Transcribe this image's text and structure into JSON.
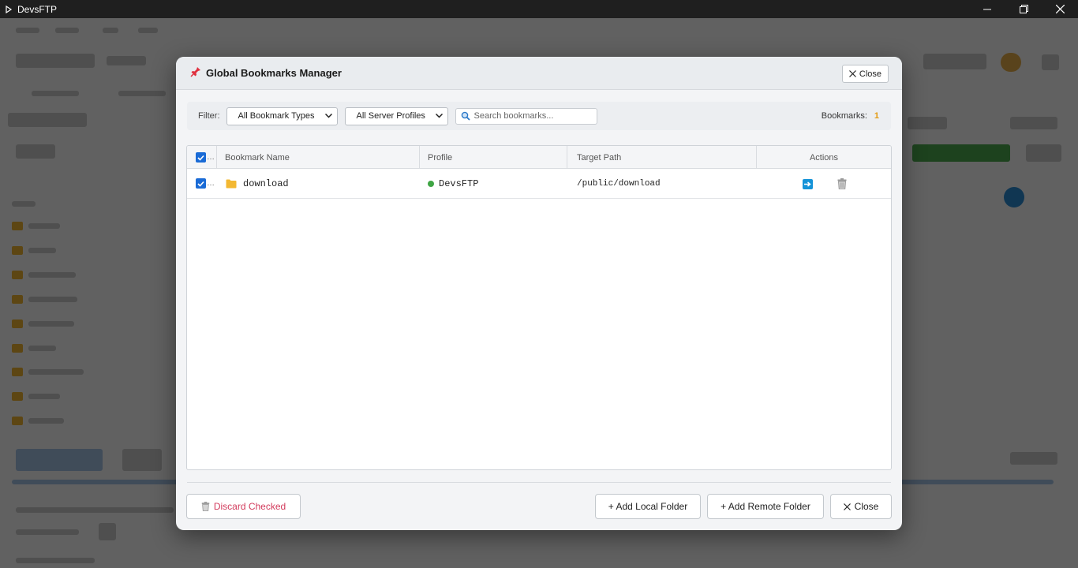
{
  "window": {
    "title": "DevsFTP"
  },
  "modal": {
    "title": "Global Bookmarks Manager",
    "close_label": "Close",
    "filter": {
      "label": "Filter:",
      "type_select": "All Bookmark Types",
      "profile_select": "All Server Profiles",
      "search_placeholder": "Search bookmarks...",
      "count_label": "Bookmarks:",
      "count": "1"
    },
    "table": {
      "columns": [
        "Bookmark Name",
        "Profile",
        "Target Path",
        "Actions"
      ],
      "rows": [
        {
          "name": "download",
          "profile": "DevsFTP",
          "path": "/public/download",
          "checked": true,
          "profile_status_color": "#3fa544"
        }
      ]
    },
    "footer": {
      "discard_label": "Discard Checked",
      "add_local_label": "+ Add Local Folder",
      "add_remote_label": "+ Add Remote Folder",
      "close_label": "Close"
    }
  },
  "colors": {
    "accent": "#1a6bd6",
    "count": "#e39b12",
    "danger": "#d23b5c",
    "folder": "#f3b832",
    "navigate": "#1493d8"
  }
}
